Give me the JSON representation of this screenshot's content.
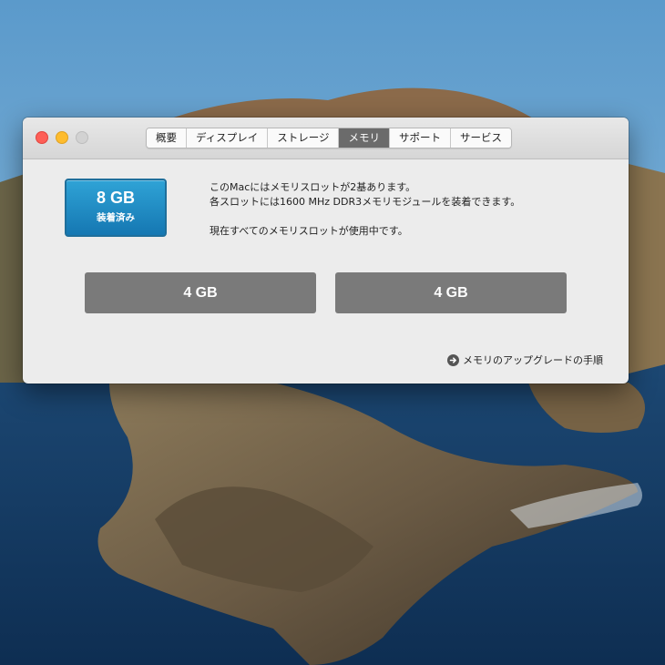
{
  "window": {
    "tabs": [
      {
        "label": "概要",
        "active": false
      },
      {
        "label": "ディスプレイ",
        "active": false
      },
      {
        "label": "ストレージ",
        "active": false
      },
      {
        "label": "メモリ",
        "active": true
      },
      {
        "label": "サポート",
        "active": false
      },
      {
        "label": "サービス",
        "active": false
      }
    ]
  },
  "memory": {
    "total": "8 GB",
    "total_label": "装着済み",
    "info_line1": "このMacにはメモリスロットが2基あります。",
    "info_line2": "各スロットには1600 MHz DDR3メモリモジュールを装着できます。",
    "info_line3": "現在すべてのメモリスロットが使用中です。",
    "slots": [
      {
        "size": "4 GB"
      },
      {
        "size": "4 GB"
      }
    ],
    "upgrade_link": "メモリのアップグレードの手順"
  },
  "colors": {
    "accent": "#1f86c4",
    "active_tab": "#6b6b6b",
    "slot": "#7a7a7a"
  },
  "icons": {
    "upgrade": "arrow-right-circle-icon"
  }
}
